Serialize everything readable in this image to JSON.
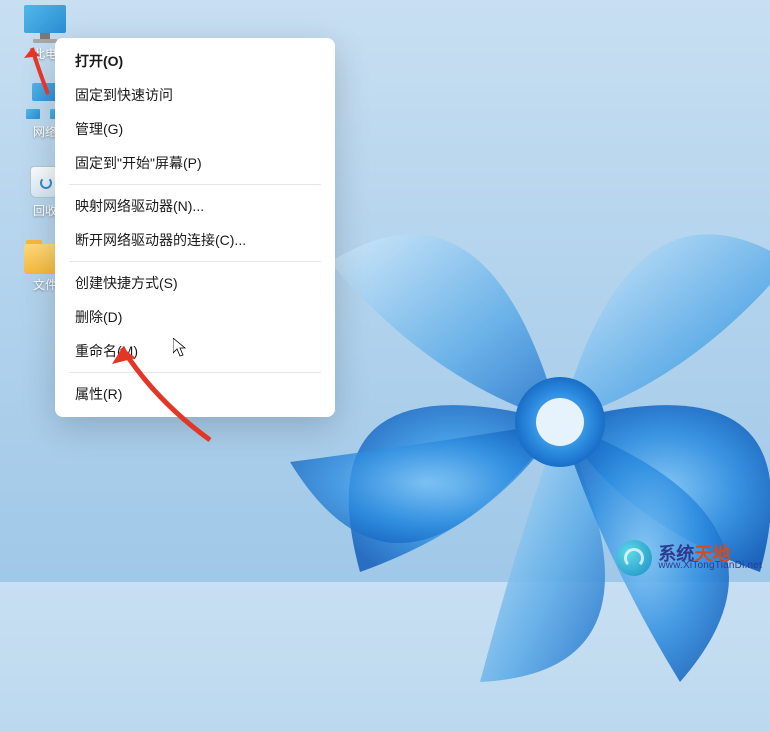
{
  "desktop": {
    "icons": [
      {
        "id": "this-pc",
        "label": "此电"
      },
      {
        "id": "network",
        "label": "网络"
      },
      {
        "id": "recycle-bin",
        "label": "回收"
      },
      {
        "id": "files-folder",
        "label": "文件"
      }
    ]
  },
  "context_menu": {
    "groups": [
      [
        {
          "id": "open",
          "label": "打开(O)",
          "bold": true
        },
        {
          "id": "pin-quick",
          "label": "固定到快速访问"
        },
        {
          "id": "manage",
          "label": "管理(G)"
        },
        {
          "id": "pin-start",
          "label": "固定到\"开始\"屏幕(P)"
        }
      ],
      [
        {
          "id": "map-drive",
          "label": "映射网络驱动器(N)..."
        },
        {
          "id": "disconnect-drive",
          "label": "断开网络驱动器的连接(C)..."
        }
      ],
      [
        {
          "id": "create-shortcut",
          "label": "创建快捷方式(S)"
        },
        {
          "id": "delete",
          "label": "删除(D)"
        },
        {
          "id": "rename",
          "label": "重命名(M)"
        }
      ],
      [
        {
          "id": "properties",
          "label": "属性(R)"
        }
      ]
    ]
  },
  "watermark": {
    "brand_part1": "系统",
    "brand_part2": "天地",
    "url": "www.XiTongTianDi.net",
    "color_primary": "#2f3a8f",
    "color_accent": "#d94a1a"
  },
  "annotations": {
    "arrow_color": "#e33627"
  }
}
